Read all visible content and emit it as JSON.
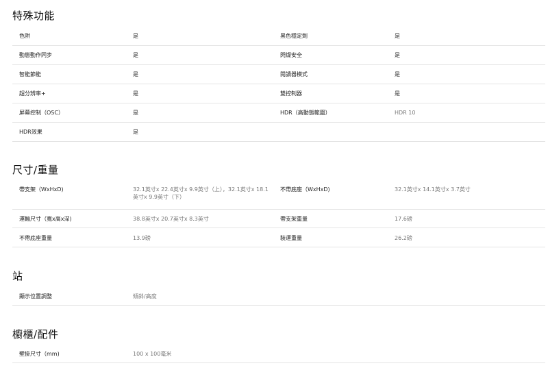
{
  "sections": [
    {
      "title": "特殊功能",
      "rows": [
        {
          "l1": "色阱",
          "v1": "是",
          "l2": "黑色穩定劑",
          "v2": "是"
        },
        {
          "l1": "動態動作同步",
          "v1": "是",
          "l2": "閃燦安全",
          "v2": "是"
        },
        {
          "l1": "智能節能",
          "v1": "是",
          "l2": "閱讀器模式",
          "v2": "是"
        },
        {
          "l1": "超分辨率+",
          "v1": "是",
          "l2": "雙控制器",
          "v2": "是"
        },
        {
          "l1": "屏幕控制（OSC）",
          "v1": "是",
          "l2": "HDR（高動態範圍）",
          "v2": "HDR 10"
        },
        {
          "l1": "HDR效果",
          "v1": "是",
          "l2": "",
          "v2": ""
        }
      ]
    },
    {
      "title": "尺寸/重量",
      "rows": [
        {
          "l1": "帶支架（WxHxD)",
          "v1": "32.1英寸x 22.4英寸x 9.9英寸（上），32.1英寸x 18.1英寸x 9.9英寸（下）",
          "l2": "不帶底座（WxHxD)",
          "v2": "32.1英寸x 14.1英寸x 3.7英寸"
        },
        {
          "l1": "運輸尺寸（寬x高x深)",
          "v1": "38.8英寸x 20.7英寸x 8.3英寸",
          "l2": "帶支架重量",
          "v2": "17.6磅"
        },
        {
          "l1": "不帶底座重量",
          "v1": "13.9磅",
          "l2": "裝運重量",
          "v2": "26.2磅"
        }
      ]
    },
    {
      "title": "站",
      "rows": [
        {
          "l1": "顯示位置調整",
          "v1": "傾斜/高度",
          "l2": "",
          "v2": ""
        }
      ]
    },
    {
      "title": "櫥櫃/配件",
      "rows": [
        {
          "l1": "壁掛尺寸（mm)",
          "v1": "100 x 100毫米",
          "l2": "",
          "v2": ""
        }
      ]
    }
  ]
}
